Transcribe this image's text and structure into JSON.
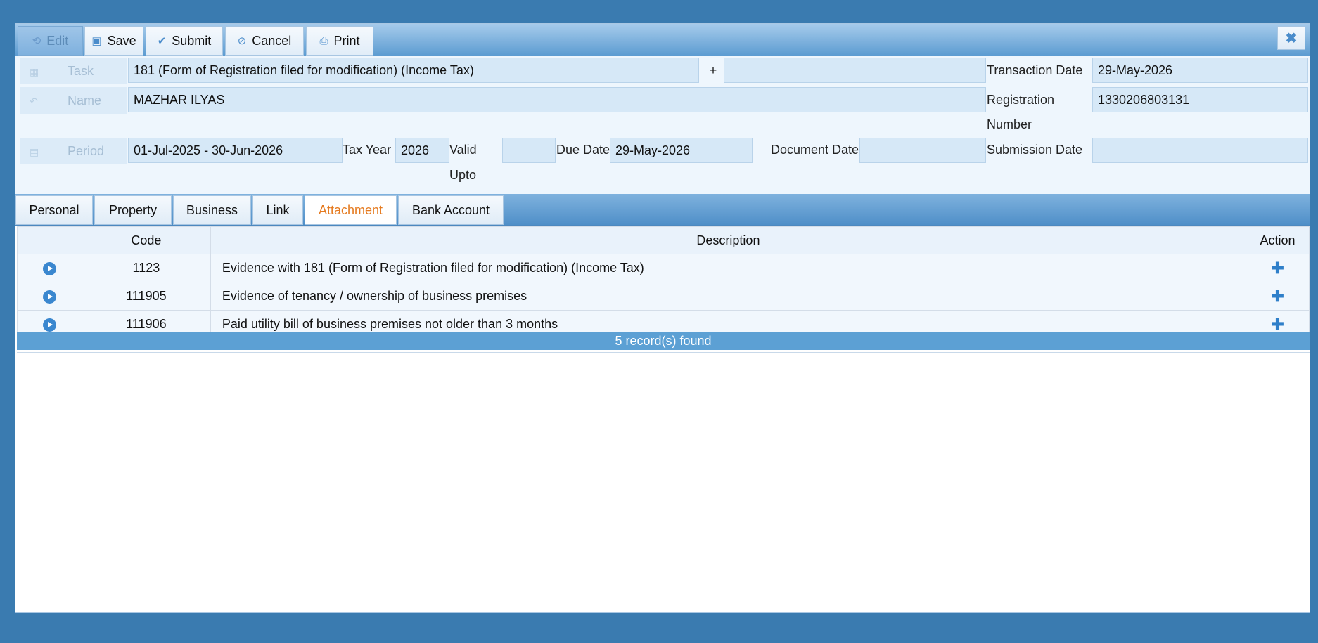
{
  "toolbar": {
    "buttons": [
      {
        "label": "Edit",
        "icon": "refresh-icon",
        "disabled": true
      },
      {
        "label": "Save",
        "icon": "floppy-icon"
      },
      {
        "label": "Submit",
        "icon": "check-icon"
      },
      {
        "label": "Cancel",
        "icon": "cancel-icon"
      },
      {
        "label": "Print",
        "icon": "printer-icon"
      }
    ],
    "close_icon": "close-icon"
  },
  "form": {
    "task_label": "Task",
    "task_value": "181 (Form of Registration filed for modification) (Income Tax)",
    "task_plus": "+",
    "task_extra_value": "",
    "transaction_date_label": "Transaction Date",
    "transaction_date_value": "29-May-2026",
    "name_label": "Name",
    "name_value": "MAZHAR ILYAS",
    "registration_label_line1": "Registration",
    "registration_label_line2": "Number",
    "registration_value": "1330206803131",
    "period_label": "Period",
    "period_value": "01-Jul-2025 -  30-Jun-2026",
    "tax_year_label": "Tax Year",
    "tax_year_value": "2026",
    "valid_upto_label_line1": "Valid",
    "valid_upto_label_line2": "Upto",
    "valid_upto_value": "",
    "due_date_label": "Due Date",
    "due_date_value": "29-May-2026",
    "document_date_label": "Document Date",
    "document_date_value": "",
    "submission_date_label": "Submission Date",
    "submission_date_value": ""
  },
  "tabs": [
    {
      "label": "Personal"
    },
    {
      "label": "Property"
    },
    {
      "label": "Business"
    },
    {
      "label": "Link"
    },
    {
      "label": "Attachment",
      "active": true
    },
    {
      "label": "Bank Account"
    }
  ],
  "table": {
    "headers": {
      "code": "Code",
      "description": "Description",
      "action": "Action"
    },
    "rows": [
      {
        "code": "1123",
        "description": "Evidence with 181 (Form of Registration filed for modification) (Income Tax)"
      },
      {
        "code": "111905",
        "description": "Evidence of tenancy / ownership of business premises"
      },
      {
        "code": "111906",
        "description": "Paid utility bill of business premises not older than 3 months"
      }
    ],
    "footer": "5 record(s) found"
  },
  "colors": {
    "background": "#3a7bb0",
    "toolbar": "#5b9bd1",
    "active_tab_text": "#e57a1f",
    "field_bg": "#d6e8f7",
    "footer_bar": "#5ca0d4"
  }
}
